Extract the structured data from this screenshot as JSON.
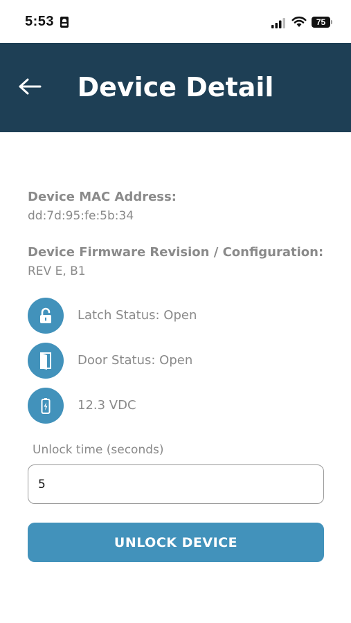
{
  "status_bar": {
    "time": "5:53",
    "battery": "75"
  },
  "header": {
    "title": "Device Detail",
    "back_icon": "arrow-left-icon",
    "background_color": "#1e3f55"
  },
  "device": {
    "mac_label": "Device MAC Address:",
    "mac_value": "dd:7d:95:fe:5b:34",
    "firmware_label": "Device Firmware Revision / Configuration:",
    "firmware_value": "REV E, B1"
  },
  "statuses": [
    {
      "icon": "unlocked-padlock-icon",
      "text": "Latch Status: Open"
    },
    {
      "icon": "open-door-icon",
      "text": "Door Status: Open"
    },
    {
      "icon": "battery-charging-icon",
      "text": "12.3 VDC"
    }
  ],
  "unlock": {
    "label": "Unlock time (seconds)",
    "value": "5",
    "button_label": "UNLOCK DEVICE"
  },
  "colors": {
    "accent": "#4292bb",
    "header": "#1e3f55"
  }
}
